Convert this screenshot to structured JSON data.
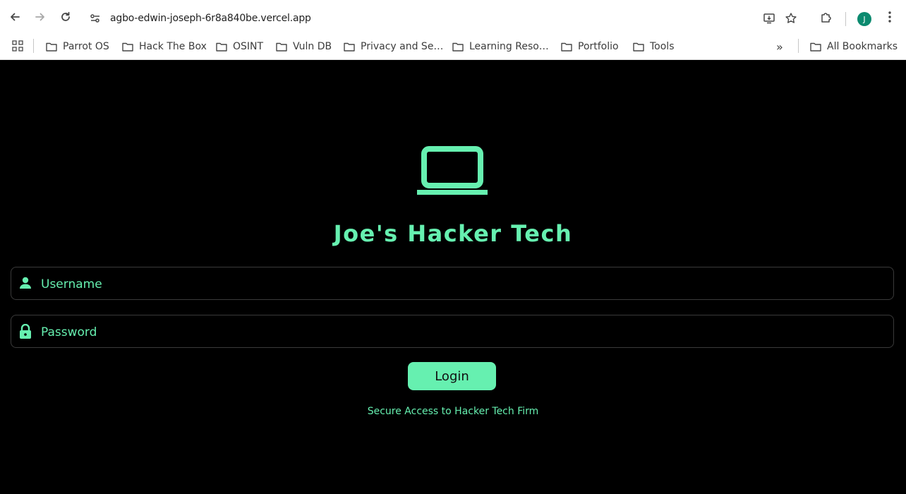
{
  "browser": {
    "url": "agbo-edwin-joseph-6r8a840be.vercel.app",
    "profile_initial": "J",
    "bookmarks": [
      "Parrot OS",
      "Hack The Box",
      "OSINT",
      "Vuln DB",
      "Privacy and Se…",
      "Learning Reso…",
      "Portfolio",
      "Tools"
    ],
    "overflow_label": "»",
    "all_bookmarks_label": "All Bookmarks"
  },
  "page": {
    "title": "Joe's Hacker Tech",
    "username_placeholder": "Username",
    "username_value": "",
    "password_placeholder": "Password",
    "password_value": "",
    "login_label": "Login",
    "tagline": "Secure Access to Hacker Tech Firm"
  },
  "colors": {
    "accent": "#66f0b0",
    "background": "#000000",
    "field_border": "#3a3a3a"
  },
  "icons": {
    "hero": "laptop-icon",
    "username": "person-icon",
    "password": "lock-icon"
  }
}
